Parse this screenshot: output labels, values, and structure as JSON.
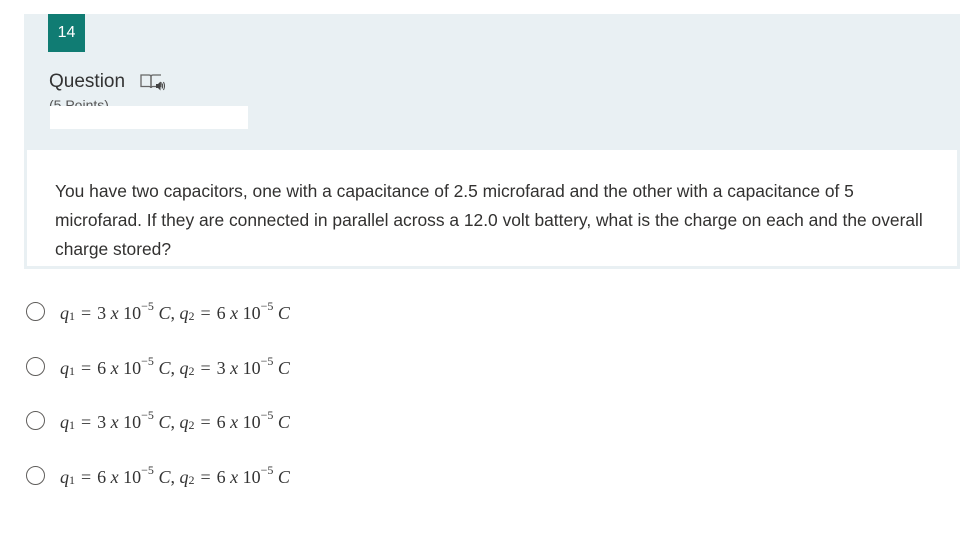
{
  "question": {
    "number": "14",
    "label": "Question",
    "points_partial": "(5 Points)",
    "text": "You have two capacitors, one with a capacitance of 2.5 microfarad and the other with a capacitance of 5 microfarad. If they are connected in parallel across a 12.0 volt battery, what is the charge on each and the overall charge stored?"
  },
  "options": [
    {
      "q1_var": "q",
      "q1_sub": "1",
      "q1_mantissa": "3",
      "q1_x": "x",
      "q1_base": "10",
      "q1_exp": "−5",
      "q1_unit": "C",
      "sep": ",",
      "q2_var": "q",
      "q2_sub": "2",
      "q2_mantissa": "6",
      "q2_x": "x",
      "q2_base": "10",
      "q2_exp": "−5",
      "q2_unit": "C"
    },
    {
      "q1_var": "q",
      "q1_sub": "1",
      "q1_mantissa": "6",
      "q1_x": "x",
      "q1_base": "10",
      "q1_exp": "−5",
      "q1_unit": "C",
      "sep": ",",
      "q2_var": "q",
      "q2_sub": "2",
      "q2_mantissa": "3",
      "q2_x": "x",
      "q2_base": "10",
      "q2_exp": "−5",
      "q2_unit": "C"
    },
    {
      "q1_var": "q",
      "q1_sub": "1",
      "q1_mantissa": "3",
      "q1_x": "x",
      "q1_base": "10",
      "q1_exp": "−5",
      "q1_unit": "C",
      "sep": ",",
      "q2_var": "q",
      "q2_sub": "2",
      "q2_mantissa": "6",
      "q2_x": "x",
      "q2_base": "10",
      "q2_exp": "−5",
      "q2_unit": "C"
    },
    {
      "q1_var": "q",
      "q1_sub": "1",
      "q1_mantissa": "6",
      "q1_x": "x",
      "q1_base": "10",
      "q1_exp": "−5",
      "q1_unit": "C",
      "sep": ",",
      "q2_var": "q",
      "q2_sub": "2",
      "q2_mantissa": "6",
      "q2_x": "x",
      "q2_base": "10",
      "q2_exp": "−5",
      "q2_unit": "C"
    }
  ],
  "equals_sign": "=",
  "icons": {
    "immersive_reader": "immersive-reader-icon",
    "radio": "radio-button-icon"
  },
  "colors": {
    "badge_bg": "#107c73",
    "panel_bg": "#e9f0f3",
    "text": "#323130"
  }
}
